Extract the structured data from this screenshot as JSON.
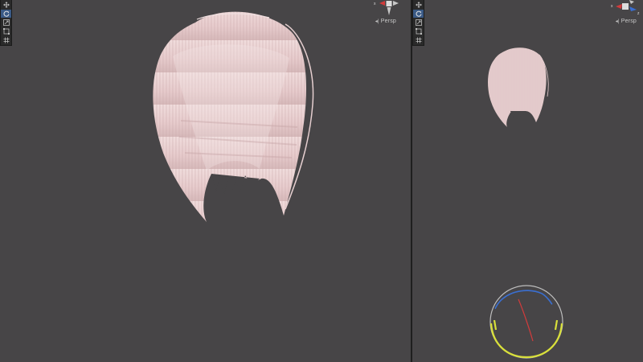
{
  "left_viewport": {
    "camera_label": "Persp",
    "toolbar": {
      "tools": [
        {
          "icon": "move-tool-icon",
          "active": false
        },
        {
          "icon": "rotate-tool-icon",
          "active": true
        },
        {
          "icon": "scale-tool-icon",
          "active": false
        },
        {
          "icon": "rect-tool-icon",
          "active": false
        },
        {
          "icon": "transform-tool-icon",
          "active": false
        }
      ]
    },
    "gizmo": {
      "axis_label": "x"
    }
  },
  "right_viewport": {
    "camera_label": "Persp",
    "toolbar": {
      "tools": [
        {
          "icon": "move-tool-icon",
          "active": false
        },
        {
          "icon": "rotate-tool-icon",
          "active": true
        },
        {
          "icon": "scale-tool-icon",
          "active": false
        },
        {
          "icon": "rect-tool-icon",
          "active": false
        },
        {
          "icon": "transform-tool-icon",
          "active": false
        }
      ]
    },
    "gizmo": {
      "axis_label_x": "x",
      "axis_label_z": "z"
    }
  },
  "colors": {
    "viewport_bg": "#474547",
    "hair": "#e9cfd0",
    "hair_shadow": "#b89a9c",
    "axis_x": "#d23b3b",
    "axis_y": "#8bc43a",
    "axis_z": "#3a6fd2",
    "rotate_ring_yellow": "#d9e03a"
  }
}
